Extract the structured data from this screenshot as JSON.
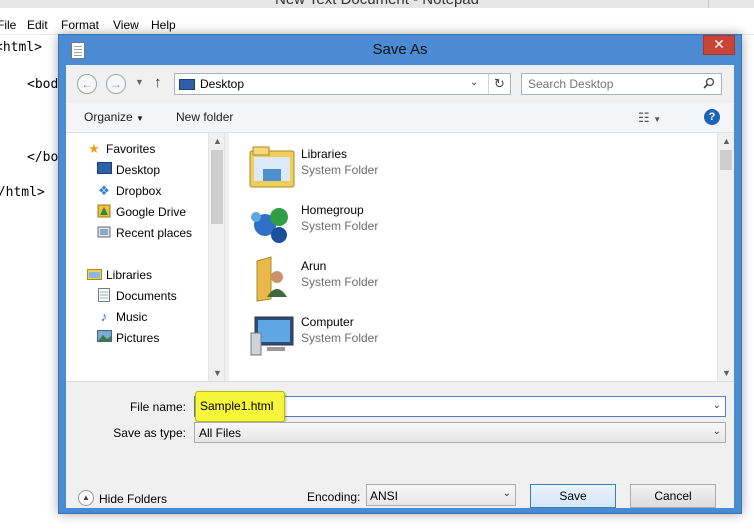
{
  "notepad": {
    "title": "New Text Document - Notepad",
    "menu": [
      "File",
      "Edit",
      "Format",
      "View",
      "Help"
    ],
    "code_lines": [
      "<html>",
      "<body>",
      "</body>",
      "</html>"
    ]
  },
  "dialog": {
    "title": "Save As",
    "close_label": "✕",
    "address": {
      "location": "Desktop"
    },
    "search": {
      "placeholder": "Search Desktop"
    },
    "toolbar": {
      "organize_label": "Organize",
      "new_folder_label": "New folder"
    },
    "nav_tree": {
      "favorites_label": "Favorites",
      "items": [
        {
          "label": "Desktop",
          "icon": "desktop-icon"
        },
        {
          "label": "Dropbox",
          "icon": "dropbox-icon"
        },
        {
          "label": "Google Drive",
          "icon": "google-drive-icon"
        },
        {
          "label": "Recent places",
          "icon": "recent-places-icon"
        }
      ],
      "libraries_label": "Libraries",
      "library_items": [
        {
          "label": "Documents",
          "icon": "documents-icon"
        },
        {
          "label": "Music",
          "icon": "music-icon"
        },
        {
          "label": "Pictures",
          "icon": "pictures-icon"
        }
      ]
    },
    "files": [
      {
        "name": "Libraries",
        "type": "System Folder",
        "icon": "libraries-icon"
      },
      {
        "name": "Homegroup",
        "type": "System Folder",
        "icon": "homegroup-icon"
      },
      {
        "name": "Arun",
        "type": "System Folder",
        "icon": "user-folder-icon"
      },
      {
        "name": "Computer",
        "type": "System Folder",
        "icon": "computer-icon"
      }
    ],
    "form": {
      "file_name_label": "File name:",
      "file_name_value": "Sample1.html",
      "save_as_type_label": "Save as type:",
      "save_as_type_value": "All Files",
      "hide_folders_label": "Hide Folders",
      "encoding_label": "Encoding:",
      "encoding_value": "ANSI",
      "save_label": "Save",
      "cancel_label": "Cancel"
    },
    "colors": {
      "frame": "#4a8bd4",
      "close_button": "#c74437",
      "highlight": "#f5f53a"
    }
  }
}
